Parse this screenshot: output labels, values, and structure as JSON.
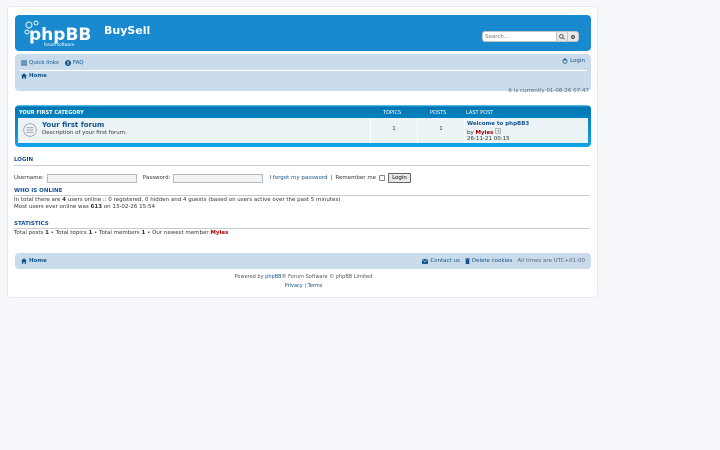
{
  "header": {
    "site_name": "BuySell",
    "search_placeholder": "Search…"
  },
  "nav": {
    "quick_links": "Quick links",
    "faq": "FAQ",
    "login": "Login",
    "home": "Home"
  },
  "time_line": "It is currently 01-08-26 07:47",
  "category": {
    "title": "Your first category",
    "col_topics": "Topics",
    "col_posts": "Posts",
    "col_last_post": "Last post",
    "forum": {
      "title": "Your first forum",
      "description": "Description of your first forum.",
      "topics": "1",
      "posts": "1",
      "last_post_title": "Welcome to phpBB3",
      "last_post_by": "by",
      "last_post_user": "Myles",
      "last_post_time": "26-11-21 00:15"
    }
  },
  "login": {
    "heading": "Login",
    "username_label": "Username:",
    "password_label": "Password:",
    "forgot": "I forgot my password",
    "separator": "|",
    "remember": "Remember me",
    "button": "Login"
  },
  "who_online": {
    "heading": "Who is online",
    "line1_pre": "In total there are",
    "line1_count": "4",
    "line1_post": "users online :: 0 registered, 0 hidden and 4 guests (based on users active over the past 5 minutes)",
    "line2_pre": "Most users ever online was",
    "line2_count": "613",
    "line2_post": "on 13-02-26 15:54"
  },
  "statistics": {
    "heading": "Statistics",
    "total_posts_label": "Total posts",
    "total_posts": "1",
    "total_topics_label": "Total topics",
    "total_topics": "1",
    "total_members_label": "Total members",
    "total_members": "1",
    "newest_label": "Our newest member",
    "newest_member": "Myles",
    "bullet": "•"
  },
  "footer": {
    "home": "Home",
    "contact": "Contact us",
    "delete_cookies": "Delete cookies",
    "timezone": "All times are UTC+01:00",
    "powered_pre": "Powered by",
    "phpbb": "phpBB",
    "powered_post": "® Forum Software © phpBB Limited",
    "privacy": "Privacy",
    "terms": "Terms",
    "sep": "|"
  },
  "colors": {
    "header_bg": "#1a8ad0",
    "navbar_bg": "#cadceb",
    "link": "#105289",
    "username_red": "#AA0000"
  }
}
